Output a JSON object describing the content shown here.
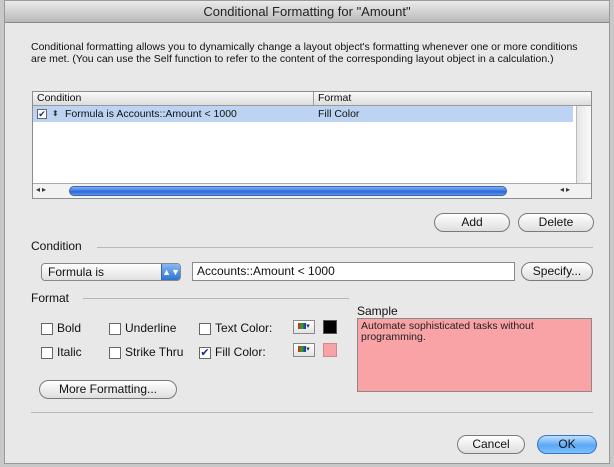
{
  "window": {
    "title": "Conditional Formatting for \"Amount\""
  },
  "description": "Conditional formatting allows you to dynamically change a layout object's formatting whenever one or more conditions are met.  (You can use the Self function to refer to the content of the corresponding layout object in a calculation.)",
  "table": {
    "columns": [
      "Condition",
      "Format"
    ],
    "rows": [
      {
        "checked": true,
        "condition": "Formula is Accounts::Amount < 1000",
        "format": "Fill Color"
      }
    ]
  },
  "buttons": {
    "add": "Add",
    "delete": "Delete",
    "specify": "Specify...",
    "more_formatting": "More Formatting...",
    "cancel": "Cancel",
    "ok": "OK"
  },
  "condition": {
    "section_label": "Condition",
    "type": "Formula is",
    "value": "Accounts::Amount < 1000"
  },
  "format": {
    "section_label": "Format",
    "bold": {
      "label": "Bold",
      "checked": false
    },
    "italic": {
      "label": "Italic",
      "checked": false
    },
    "underline": {
      "label": "Underline",
      "checked": false
    },
    "strike_thru": {
      "label": "Strike Thru",
      "checked": false
    },
    "text_color": {
      "label": "Text Color:",
      "checked": false,
      "color": "#000000"
    },
    "fill_color": {
      "label": "Fill Color:",
      "checked": true,
      "color": "#f9a3a6"
    }
  },
  "sample": {
    "label": "Sample",
    "text": "Automate sophisticated tasks without programming."
  }
}
